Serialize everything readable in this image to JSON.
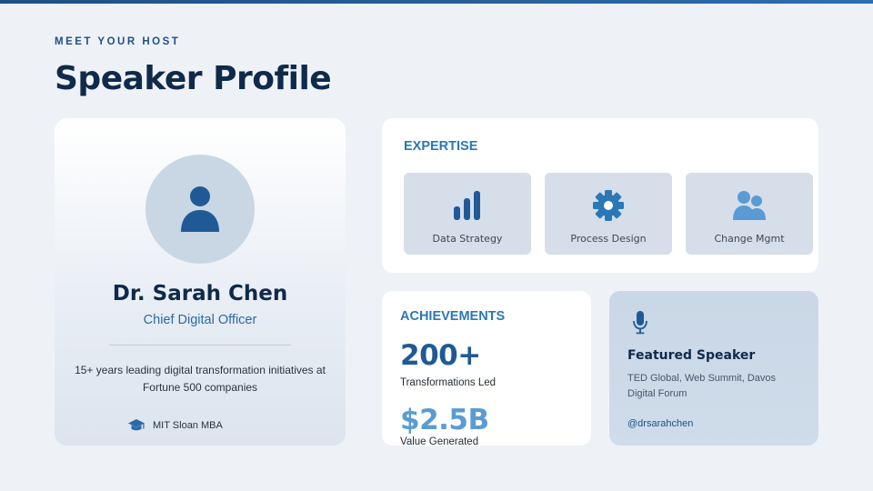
{
  "header": {
    "eyebrow": "MEET YOUR HOST",
    "title": "Speaker Profile"
  },
  "profile": {
    "name": "Dr. Sarah Chen",
    "role": "Chief Digital Officer",
    "bio": "15+ years leading digital transformation initiatives at Fortune 500 companies",
    "education": "MIT Sloan MBA",
    "avatar_icon": "user-icon",
    "education_icon": "graduation-cap-icon"
  },
  "expertise": {
    "title": "EXPERTISE",
    "items": [
      {
        "label": "Data Strategy",
        "icon": "bar-chart-icon"
      },
      {
        "label": "Process Design",
        "icon": "gear-icon"
      },
      {
        "label": "Change Mgmt",
        "icon": "users-icon"
      }
    ]
  },
  "achievements": {
    "title": "ACHIEVEMENTS",
    "stats": [
      {
        "value": "200+",
        "label": "Transformations Led"
      },
      {
        "value": "$2.5B",
        "label": "Value Generated"
      }
    ]
  },
  "featured": {
    "icon": "microphone-icon",
    "title": "Featured Speaker",
    "description": "TED Global, Web Summit, Davos Digital Forum",
    "handle": "@drsarahchen"
  },
  "colors": {
    "accent": "#2a78b8",
    "primary_dark": "#0f2a4a",
    "brand_blue": "#1f5a96",
    "light_blue": "#5b9bd5",
    "background": "#eef2f7"
  }
}
